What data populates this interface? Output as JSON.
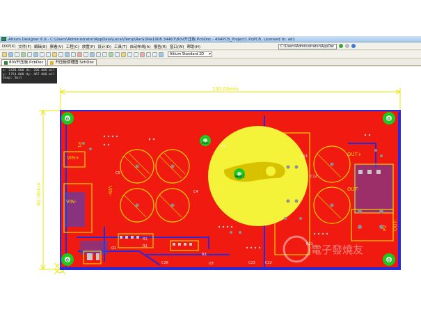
{
  "window": {
    "title": "Altium Designer 6.9 - C:\\Users\\Administrator\\AppData\\Local\\Temp\\Rar$DRa1908.34467\\80V升压板.PcbDoc - 494PCB_Project1.PrjPCB. Licensed to: ad1"
  },
  "menu": {
    "items": [
      "DXP(X)",
      "文件(F)",
      "编辑(E)",
      "察看(V)",
      "工程(C)",
      "放置(P)",
      "设计(D)",
      "工具(T)",
      "自动布线(A)",
      "报告(R)",
      "窗口(W)",
      "帮助(H)"
    ],
    "path_value": "C:\\Users\\Administrator\\AppDat",
    "path_arrow": "▾"
  },
  "toolbar": {
    "view_select": "Altium Standard 2D",
    "view_select_arrow": "▾"
  },
  "tabs": [
    {
      "label": "80V升压板.PcbDoc",
      "active": true
    },
    {
      "label": "升压板原理图.SchDoc",
      "active": false
    }
  ],
  "readout": {
    "line1": "x: 2430.000  dx: 206.000 mil",
    "line2": "y: 1754.000  dy: 467.000 mil",
    "line3": "Snap: 5mil"
  },
  "dimensions": {
    "width_label": "130.00mm",
    "height_label": "60.00mm"
  },
  "mounting_holes": [
    "0",
    "0",
    "0",
    "0"
  ],
  "pads": {
    "vin_pad": "1\nVIN+",
    "center_pad": "1\nNetD1_",
    "net_d1": "NetD1_"
  },
  "labels": {
    "vin_plus": "VIN+",
    "vin_minus": "VIN-",
    "vin_rot": "VIN-",
    "out_plus": "OUT+",
    "out_minus": "OUT-",
    "p1": "P1",
    "p2": "P2",
    "out_rot": "OUT-",
    "ref_c5": "C5",
    "ref_c4": "C4",
    "ref_c13": "C13",
    "ref_c12": "C12",
    "ref_r1": "R1",
    "ref_r2": "R2",
    "ref_u1": "U1",
    "ref_q1": "Q1",
    "ref_c26": "C26",
    "ref_r3": "R3",
    "ref_c22": "C22",
    "ref_u3": "U3",
    "ref_r21": "R21",
    "ref_c23": "C23"
  },
  "watermark": "電子發燒友",
  "colors": {
    "board": "#f01a10",
    "outline": "#2a2ad8",
    "inductor": "#f5f23a",
    "dimension": "#e8e800",
    "pad_green": "#1fc81f",
    "silk": "#f5d000"
  }
}
